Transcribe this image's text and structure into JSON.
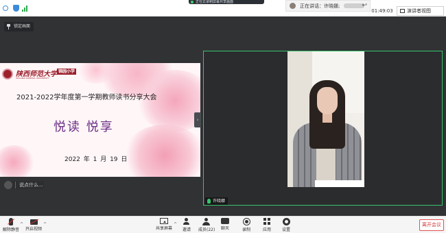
{
  "top": {
    "recording_banner": "正在云录制屏幕共享画面",
    "speaking_prefix": "正在讲话：许晓娜;",
    "meeting_time": "01:49:03",
    "view_button": "演讲者视图"
  },
  "stage": {
    "pin_label": "锁定画面",
    "chat_hint": "说点什么..."
  },
  "slide": {
    "logo_text": "陕西师范大学",
    "logo_subtext": "SHAANXI NORMAL UNIVERSITY",
    "school_badge": "锦园小学",
    "title": "2021-2022学年度第一学期教师读书分享大会",
    "heading": "悦读  悦享",
    "date": "2022 年 1 月 19 日"
  },
  "video": {
    "participant_name": "许晓娜"
  },
  "toolbar": {
    "mute": "解除静音",
    "video": "开启视频",
    "share": "共享屏幕",
    "invite": "邀请",
    "members": "成员(22)",
    "chat": "聊天",
    "record": "录制",
    "apps": "应用",
    "settings": "设置",
    "leave": "离开会议"
  },
  "colors": {
    "accent_green": "#38c56f",
    "leave_red": "#d23a3a",
    "slide_purple": "#6a2e85",
    "university_red": "#9c1f2c"
  }
}
